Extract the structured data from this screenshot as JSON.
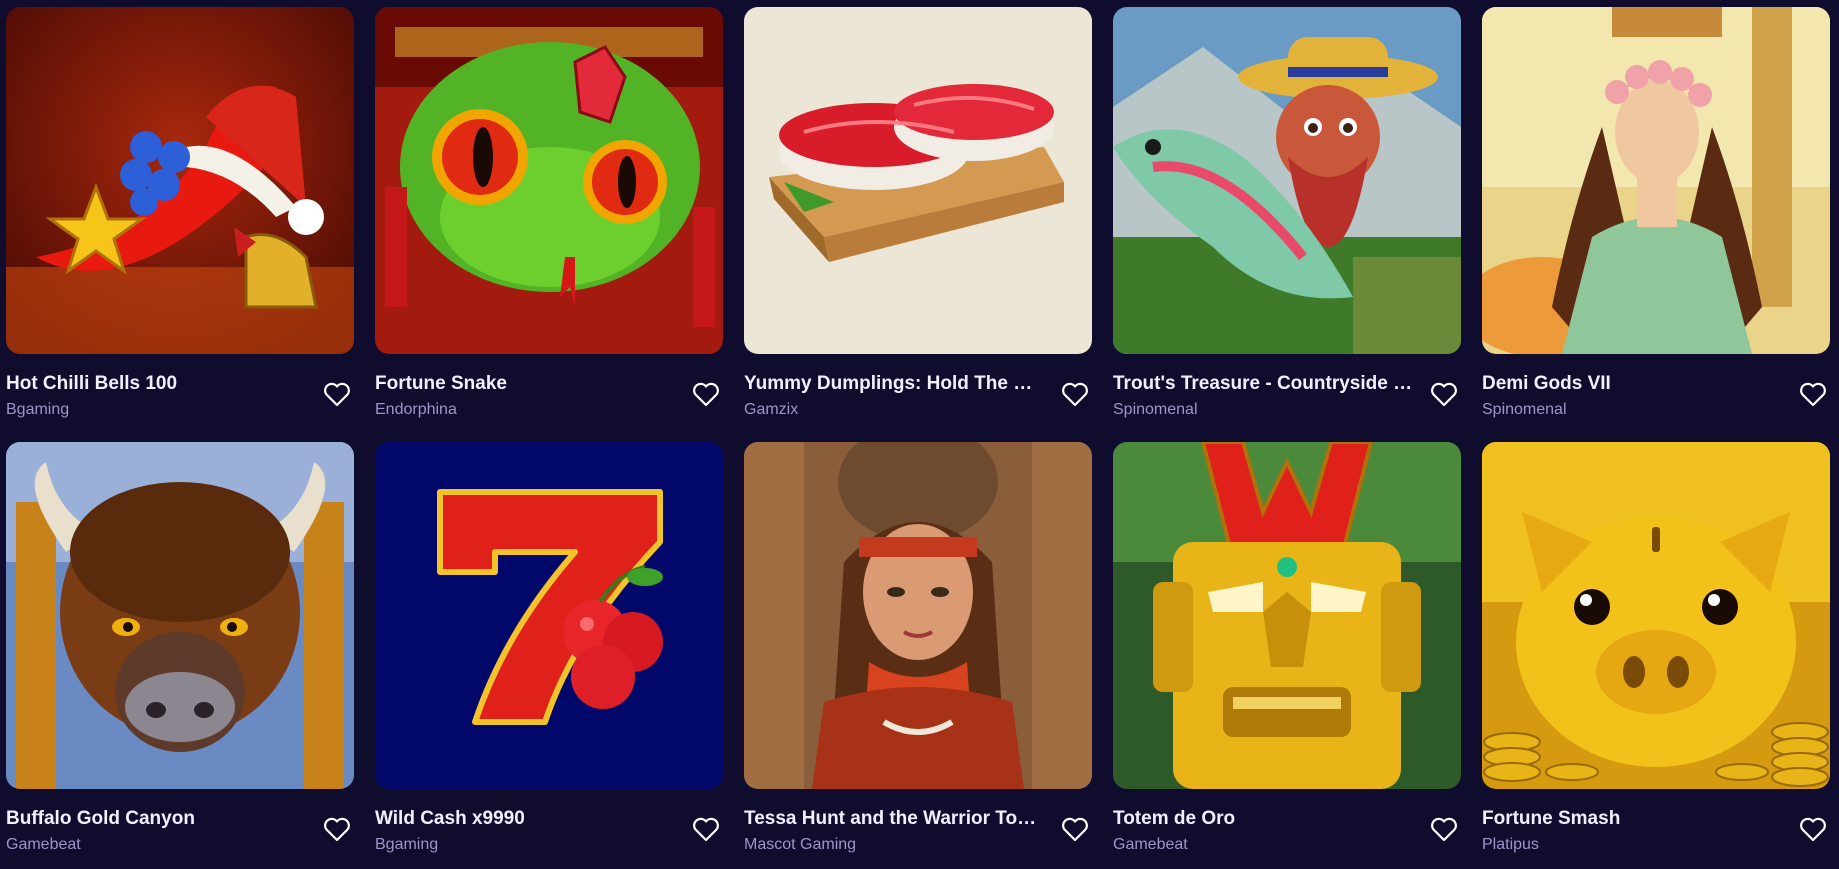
{
  "games": [
    {
      "title": "Hot Chilli Bells 100",
      "provider": "Bgaming",
      "art": "chili",
      "favorite": false
    },
    {
      "title": "Fortune Snake",
      "provider": "Endorphina",
      "art": "snake",
      "favorite": false
    },
    {
      "title": "Yummy Dumplings: Hold The Spin",
      "provider": "Gamzix",
      "art": "sushi",
      "favorite": false
    },
    {
      "title": "Trout's Treasure - Countryside Quest",
      "provider": "Spinomenal",
      "art": "fisherman",
      "favorite": false
    },
    {
      "title": "Demi Gods VII",
      "provider": "Spinomenal",
      "art": "goddess",
      "favorite": false
    },
    {
      "title": "Buffalo Gold Canyon",
      "provider": "Gamebeat",
      "art": "buffalo",
      "favorite": false
    },
    {
      "title": "Wild Cash x9990",
      "provider": "Bgaming",
      "art": "seven",
      "favorite": false
    },
    {
      "title": "Tessa Hunt and the Warrior Tomb",
      "provider": "Mascot Gaming",
      "art": "explorer",
      "favorite": false
    },
    {
      "title": "Totem de Oro",
      "provider": "Gamebeat",
      "art": "totem",
      "favorite": false
    },
    {
      "title": "Fortune Smash",
      "provider": "Platipus",
      "art": "piggy",
      "favorite": false
    }
  ],
  "colors": {
    "background": "#0f0c2e",
    "title": "#f2f0ff",
    "provider": "#9c97c9",
    "heart": "#ffffff"
  },
  "icons": {
    "favorite": "heart-outline-icon"
  }
}
